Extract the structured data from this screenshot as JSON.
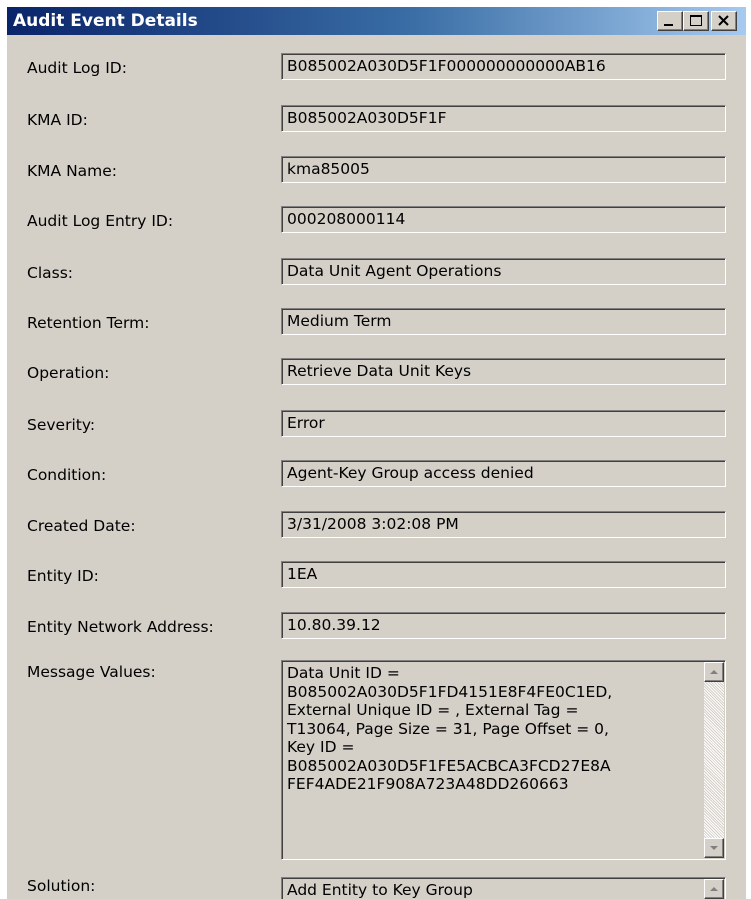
{
  "window": {
    "title": "Audit Event Details",
    "controls": {
      "minimize_icon": "minimize-icon",
      "maximize_icon": "maximize-icon",
      "close_icon": "close-icon"
    }
  },
  "fields": [
    {
      "label": "Audit Log ID:",
      "value": "B085002A030D5F1F000000000000AB16"
    },
    {
      "label": "KMA ID:",
      "value": "B085002A030D5F1F"
    },
    {
      "label": "KMA Name:",
      "value": "kma85005"
    },
    {
      "label": "Audit Log Entry ID:",
      "value": "000208000114"
    },
    {
      "label": "Class:",
      "value": "Data Unit Agent Operations"
    },
    {
      "label": "Retention Term:",
      "value": "Medium Term"
    },
    {
      "label": "Operation:",
      "value": "Retrieve Data Unit Keys"
    },
    {
      "label": "Severity:",
      "value": "Error"
    },
    {
      "label": "Condition:",
      "value": "Agent-Key Group access denied"
    },
    {
      "label": "Created Date:",
      "value": "3/31/2008 3:02:08 PM"
    },
    {
      "label": "Entity ID:",
      "value": "1EA"
    },
    {
      "label": "Entity Network Address:",
      "value": "10.80.39.12"
    }
  ],
  "message_values": {
    "label": "Message Values:",
    "value": "Data Unit ID =\nB085002A030D5F1FD4151E8F4FE0C1ED,\nExternal Unique ID = , External Tag =\nT13064, Page Size = 31, Page Offset = 0,\nKey ID =\nB085002A030D5F1FE5ACBCA3FCD27E8A\nFEF4ADE21F908A723A48DD260663"
  },
  "solution": {
    "label": "Solution:",
    "value": "Add Entity to Key Group"
  },
  "colors": {
    "window_bg": "#d4d0c8",
    "titlebar_start": "#0a246a",
    "titlebar_end": "#a6caf0",
    "title_text": "#ffffff"
  }
}
